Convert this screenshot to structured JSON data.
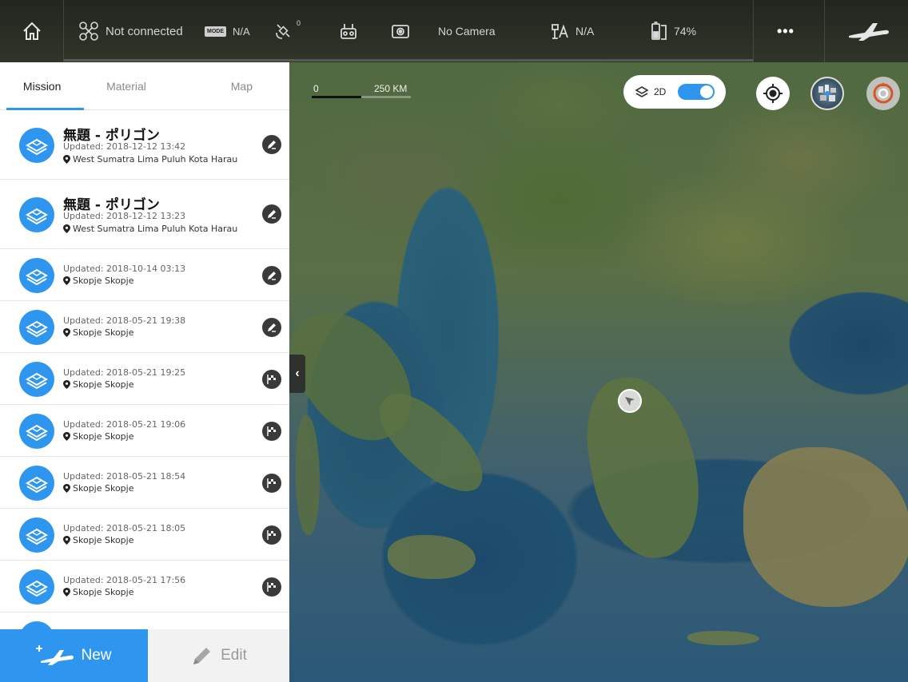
{
  "topbar": {
    "connection": "Not connected",
    "mode_badge": "MODE",
    "mode_value": "N/A",
    "gps_count": "0",
    "camera": "No Camera",
    "rtk": "N/A",
    "battery": "74%",
    "more": "•••"
  },
  "tabs": [
    {
      "label": "Mission"
    },
    {
      "label": "Material"
    },
    {
      "label": "Map"
    }
  ],
  "missions": [
    {
      "title": "無題 - ポリゴン",
      "updated": "Updated: 2018-12-12 13:42",
      "location": "West Sumatra Lima Puluh Kota Harau",
      "action": "edit-icon"
    },
    {
      "title": "無題 - ポリゴン",
      "updated": "Updated: 2018-12-12 13:23",
      "location": "West Sumatra Lima Puluh Kota Harau",
      "action": "edit-icon"
    },
    {
      "title": "",
      "updated": "Updated: 2018-10-14 03:13",
      "location": "Skopje Skopje",
      "action": "edit-icon"
    },
    {
      "title": "",
      "updated": "Updated: 2018-05-21 19:38",
      "location": "Skopje Skopje",
      "action": "edit-icon"
    },
    {
      "title": "",
      "updated": "Updated: 2018-05-21 19:25",
      "location": "Skopje Skopje",
      "action": "flag-icon"
    },
    {
      "title": "",
      "updated": "Updated: 2018-05-21 19:06",
      "location": "Skopje Skopje",
      "action": "flag-icon"
    },
    {
      "title": "",
      "updated": "Updated: 2018-05-21 18:54",
      "location": "Skopje Skopje",
      "action": "flag-icon"
    },
    {
      "title": "",
      "updated": "Updated: 2018-05-21 18:05",
      "location": "Skopje Skopje",
      "action": "flag-icon"
    },
    {
      "title": "",
      "updated": "Updated: 2018-05-21 17:56",
      "location": "Skopje Skopje",
      "action": "flag-icon"
    }
  ],
  "bottom": {
    "new_label": "New",
    "edit_label": "Edit"
  },
  "map": {
    "scale_zero": "0",
    "scale_label": "250 KM",
    "view_mode": "2D",
    "view_mode_3d_enabled": true
  },
  "colors": {
    "accent": "#2f96f0",
    "topbar": "#2a2c26"
  }
}
